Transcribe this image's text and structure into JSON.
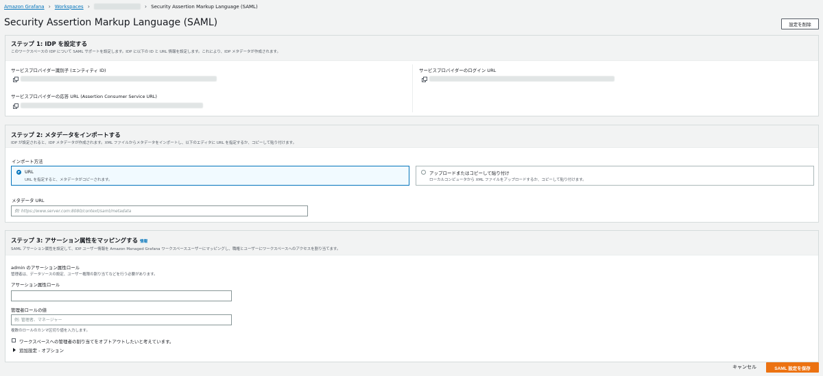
{
  "breadcrumb": {
    "items": [
      "Amazon Grafana",
      "Workspaces"
    ],
    "current": "Security Assertion Markup Language (SAML)"
  },
  "page": {
    "title": "Security Assertion Markup Language (SAML)",
    "delete_button": "設定を削除"
  },
  "step1": {
    "title": "ステップ 1: IDP を設定する",
    "desc": "このワークスペースの IDP について SAML サポートを設定します。IDP に以下の ID と URL 情報を設定します。これにより、IDP メタデータが作成されます。",
    "entity_id_label": "サービスプロバイダー識別子 (エンティティ ID)",
    "acs_url_label": "サービスプロバイダーの応答 URL (Assertion Consumer Service URL)",
    "login_url_label": "サービスプロバイダーのログイン URL"
  },
  "step2": {
    "title": "ステップ 2: メタデータをインポートする",
    "desc": "IDP が設定されると、IDP メタデータが作成されます。XML ファイルからメタデータをインポートし、以下のエディタに URL を指定するか、コピーして貼り付けます。",
    "import_method_label": "インポート方法",
    "option_url_label": "URL",
    "option_url_desc": "URL を指定すると、メタデータがコピーされます。",
    "option_upload_label": "アップロードまたはコピーして貼り付け",
    "option_upload_desc": "ローカルコンピュータから XML ファイルをアップロードするか、コピーして貼り付けます。",
    "metadata_url_label": "メタデータ URL",
    "metadata_url_placeholder": "例: https://www.server.com:8080/context/saml/metadata",
    "metadata_url_value": ""
  },
  "step3": {
    "title": "ステップ 3: アサーション属性をマッピングする",
    "info": "情報",
    "desc": "SAML アサーション属性を設定して、IDP ユーザー情報を Amazon Managed Grafana ワークスペースユーザーにマッピングし、職権とユーザーにワークスペースへのアクセスを割り当てます。",
    "admin_role_heading": "admin のアサーション属性ロール",
    "admin_role_desc": "管理者は、データソースの設定、ユーザー権限の割り当てなどを行う必要があります。",
    "assertion_role_label": "アサーション属性ロール",
    "assertion_role_value": "",
    "admin_values_label": "管理者ロールの値",
    "admin_values_placeholder": "例: 管理者、マネージャー",
    "admin_values_value": "",
    "admin_values_hint": "複数のロールのカンマ区切り値を入力します。",
    "opt_out_label": "ワークスペースへの管理者の割り当てをオプトアウトしたいと考えています。",
    "additional_settings_label": "追加設定 - オプション"
  },
  "footer": {
    "cancel_label": "キャンセル",
    "save_label": "SAML 設定を保存"
  },
  "colors": {
    "link": "#0073bb",
    "primary_button": "#ec7211",
    "selected_border": "#0073bb",
    "selected_bg": "#f1faff"
  }
}
